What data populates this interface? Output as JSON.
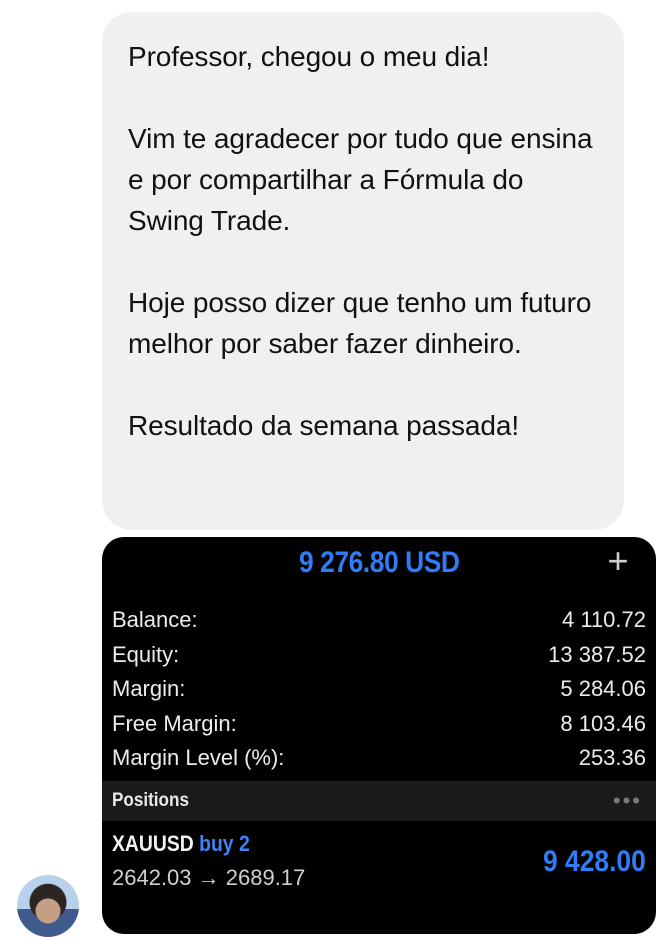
{
  "message": {
    "paragraphs": [
      "Professor, chegou o meu dia!",
      "Vim te agradecer por tudo que ensina e por compartilhar a Fórmula do Swing Trade.",
      "Hoje posso dizer que tenho um futuro melhor por saber fazer dinheiro.",
      "Resultado da semana passada!"
    ]
  },
  "trading_screenshot": {
    "equity": "9 276.80 USD",
    "add_icon": "plus-icon",
    "account": [
      {
        "label": "Balance:",
        "value": "4 110.72"
      },
      {
        "label": "Equity:",
        "value": "13 387.52"
      },
      {
        "label": "Margin:",
        "value": "5 284.06"
      },
      {
        "label": "Free Margin:",
        "value": "8 103.46"
      },
      {
        "label": "Margin Level (%):",
        "value": "253.36"
      }
    ],
    "positions_title": "Positions",
    "more_icon": "more-dots-icon",
    "position": {
      "symbol": "XAUUSD",
      "direction": "buy 2",
      "prices": "2642.03 → 2689.17",
      "profit": "9 428.00"
    },
    "accent_color": "#2f7cf6"
  },
  "sender": {
    "avatar_icon": "user-avatar"
  }
}
